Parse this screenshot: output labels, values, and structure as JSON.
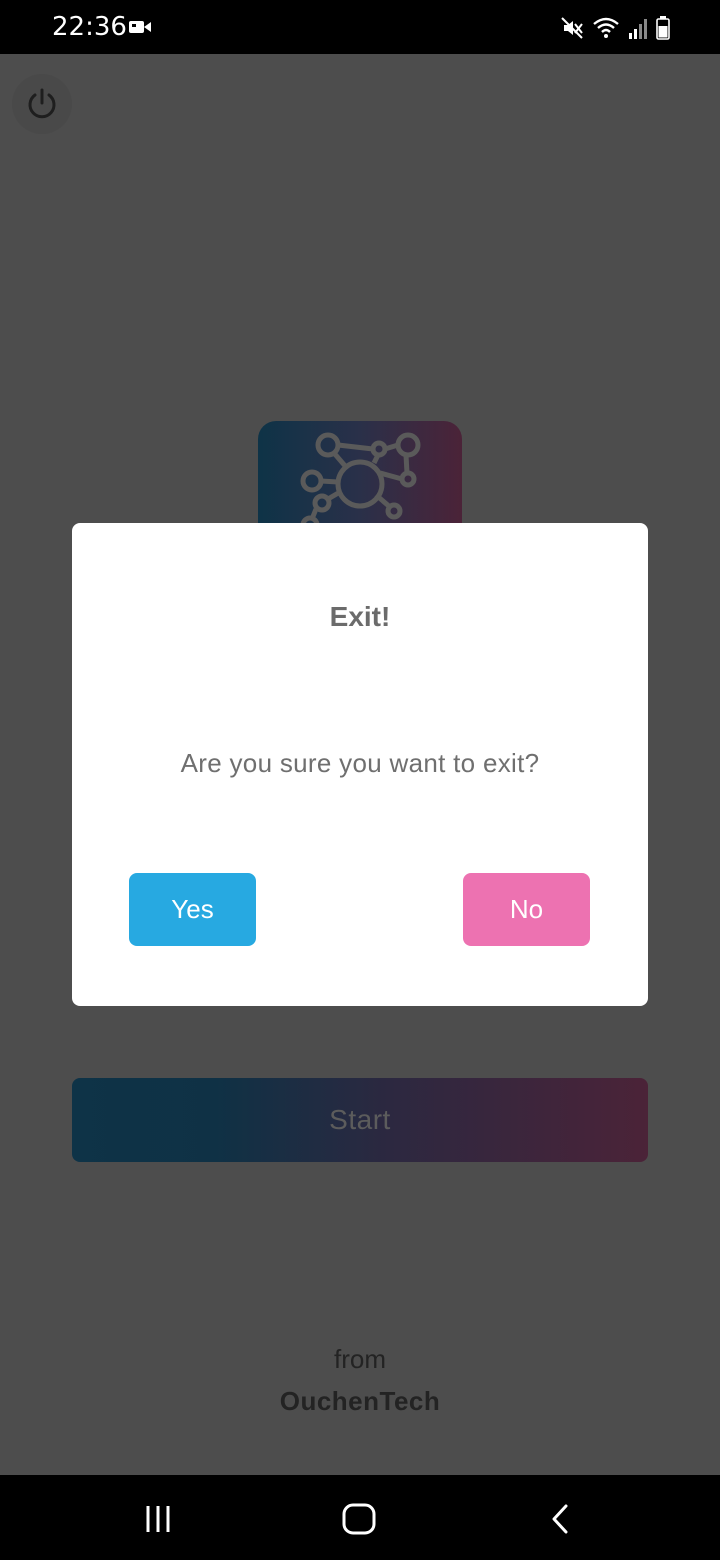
{
  "status_bar": {
    "time": "22:36",
    "icons": [
      "video-icon",
      "mute-icon",
      "wifi-icon",
      "signal-icon",
      "battery-icon"
    ]
  },
  "app": {
    "power_icon": "power-icon",
    "logo_icon": "network-hub-icon",
    "start_label": "Start",
    "footer": {
      "from_label": "from",
      "company_name": "OuchenTech"
    }
  },
  "dialog": {
    "title": "Exit!",
    "message": "Are you sure you want to exit?",
    "yes_label": "Yes",
    "no_label": "No"
  },
  "nav_bar": {
    "icons": [
      "recent-apps-icon",
      "home-icon",
      "back-icon"
    ]
  },
  "colors": {
    "overlay_background": "#4d4d4d",
    "yes_button": "#27a9e1",
    "no_button": "#ed72b1",
    "dialog_background": "#ffffff"
  }
}
